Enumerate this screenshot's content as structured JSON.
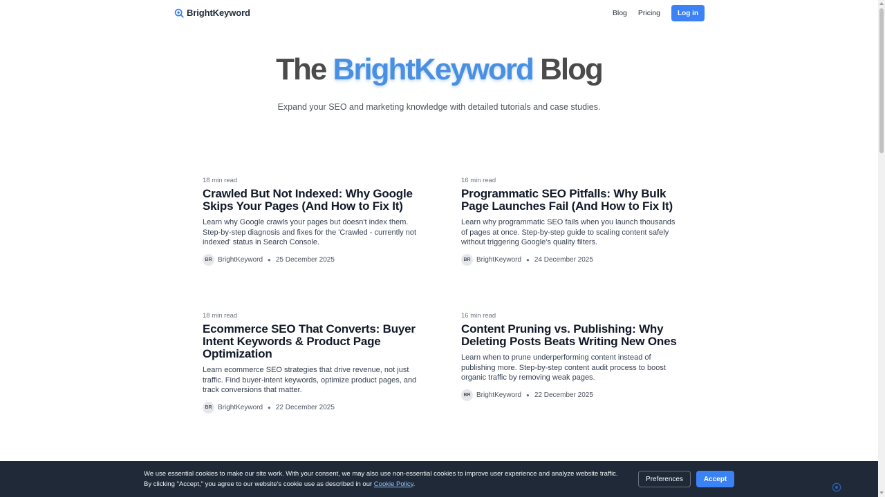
{
  "header": {
    "brand": "BrightKeyword",
    "nav": [
      "Blog",
      "Pricing"
    ],
    "login_label": "Log in"
  },
  "hero": {
    "title_pre": "The",
    "title_accent": "BrightKeyword",
    "title_post": "Blog",
    "subtitle": "Expand your SEO and marketing knowledge with detailed tutorials and case studies."
  },
  "posts": [
    {
      "read_time": "18 min read",
      "title": "Crawled But Not Indexed: Why Google Skips Your Pages (And How to Fix It)",
      "excerpt": "Learn why Google crawls your pages but doesn't index them. Step-by-step diagnosis and fixes for the 'Crawled - currently not indexed' status in Search Console.",
      "avatar": "BR",
      "author": "BrightKeyword",
      "date": "25 December 2025"
    },
    {
      "read_time": "16 min read",
      "title": "Programmatic SEO Pitfalls: Why Bulk Page Launches Fail (And How to Fix It)",
      "excerpt": "Learn why programmatic SEO fails when you launch thousands of pages at once. Step-by-step guide to scaling content safely without triggering Google's quality filters.",
      "avatar": "BR",
      "author": "BrightKeyword",
      "date": "24 December 2025"
    },
    {
      "read_time": "18 min read",
      "title": "Ecommerce SEO That Converts: Buyer Intent Keywords & Product Page Optimization",
      "excerpt": "Learn ecommerce SEO strategies that drive revenue, not just traffic. Find buyer-intent keywords, optimize product pages, and track conversions that matter.",
      "avatar": "BR",
      "author": "BrightKeyword",
      "date": "22 December 2025"
    },
    {
      "read_time": "16 min read",
      "title": "Content Pruning vs. Publishing: Why Deleting Posts Beats Writing New Ones",
      "excerpt": "Learn when to prune underperforming content instead of publishing more. Step-by-step content audit process to boost organic traffic by removing weak pages.",
      "avatar": "BR",
      "author": "BrightKeyword",
      "date": "22 December 2025"
    }
  ],
  "cookie": {
    "line1": "We use essential cookies to make our site work. With your consent, we may also use non-essential cookies to improve user experience and analyze website traffic.",
    "line2_pre": "By clicking \"Accept,\" you agree to our website's cookie use as described in our",
    "link": "Cookie Policy",
    "line2_post": ".",
    "preferences_label": "Preferences",
    "accept_label": "Accept"
  },
  "colors": {
    "accent": "#3b82f6",
    "banner_bg": "#1f2937"
  }
}
